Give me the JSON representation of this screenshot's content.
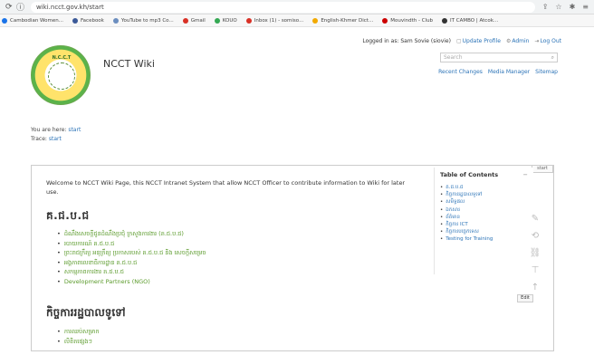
{
  "browser": {
    "url": "wiki.ncct.gov.kh/start",
    "bookmarks": [
      {
        "label": "Cambodian Women...",
        "color": "#1a73e8"
      },
      {
        "label": "Facebook",
        "color": "#3b5998"
      },
      {
        "label": "YouTube to mp3 Co...",
        "color": "#6c8ebf"
      },
      {
        "label": "Gmail",
        "color": "#d93025"
      },
      {
        "label": "KOUO",
        "color": "#34a853"
      },
      {
        "label": "Inbox (1) - somiso...",
        "color": "#d93025"
      },
      {
        "label": "English-Khmer Dict...",
        "color": "#f2a900"
      },
      {
        "label": "Mouvindth - Club",
        "color": "#cc0000"
      },
      {
        "label": "IT CAMBO | Atcok...",
        "color": "#333333"
      }
    ]
  },
  "userbar": {
    "logged_in": "Logged in as: Sam Sovie (siovie)",
    "update_profile": "Update Profile",
    "admin": "Admin",
    "logout": "Log Out"
  },
  "site": {
    "title": "NCCT Wiki",
    "logo_text": "N.C.C.T",
    "search_placeholder": "Search"
  },
  "toolnav": {
    "recent_changes": "Recent Changes",
    "media_manager": "Media Manager",
    "sitemap": "Sitemap"
  },
  "trail": {
    "you_are_here": "You are here:",
    "you_are_here_link": "start",
    "trace": "Trace:",
    "trace_link": "start"
  },
  "content": {
    "corner_tab": "start",
    "intro": "Welcome to NCCT Wiki Page, this NCCT Intranet System that allow NCCT Officer to contribute information to Wiki for later use.",
    "heading1": "គ.ជ.ប.ជ",
    "list1": [
      "ដំណឹងសេចក្តីជូនដំណឹងប្រជុំ ក្រសួងការងារ (គ.ជ.ប.ជ)",
      "របាយការណ៍ គ.ជ.ប.ជ",
      "ព្រះរាជក្រឹត្យ អនុក្រឹត្យ ប្រកាសរបស់ គ.ជ.ប.ជ និង សេចក្តីសម្រេច",
      "អង្គភាពលេខាធិការដ្ឋាន គ.ជ.ប.ជ",
      "សកម្មភាពការងារ គ.ជ.ប.ជ",
      "Development Partners (NGO)"
    ],
    "edit_button": "Edit",
    "heading2": "កិច្ចការរដ្ឋបាលទូទៅ",
    "list2": [
      "ការឈប់សម្រាក",
      "លិខិតផ្សេងៗ"
    ]
  },
  "toc": {
    "title": "Table of Contents",
    "collapse": "−",
    "items": [
      "គ.ជ.ប.ជ",
      "កិច្ចការរដ្ឋបាលទូទៅ",
      "សមិទ្ធផល",
      "ឯកសារ",
      "ព័ត៌មាន",
      "កិច្ចការ ICT",
      "កិច្ចការបច្ចេកទេស",
      "Testing for Training"
    ]
  }
}
